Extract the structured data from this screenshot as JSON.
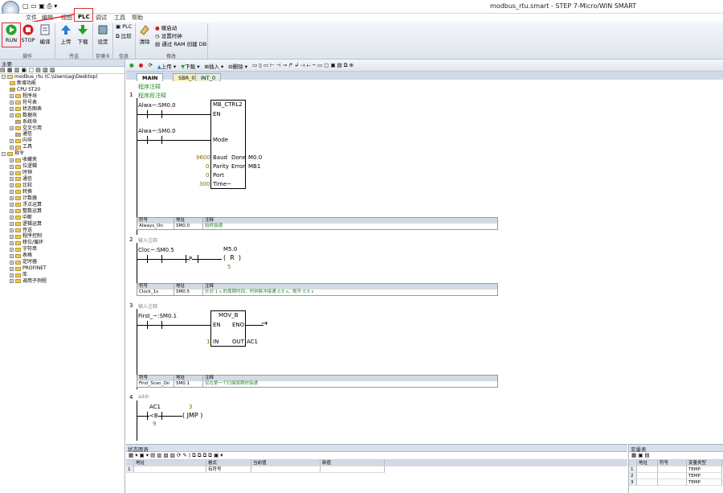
{
  "window": {
    "title": "modbus_rtu.smart - STEP 7-Micro/WIN SMART"
  },
  "menu": [
    "文件",
    "编辑",
    "视图",
    "PLC",
    "调试",
    "工具",
    "帮助"
  ],
  "ribbon": {
    "run": "RUN",
    "stop": "STOP",
    "compile": "编译",
    "upload": "上传",
    "download": "下载",
    "settings": "设定",
    "plc": "PLC",
    "compare": "比较",
    "clear": "清除",
    "power_on_reset": "暖启动",
    "set_clock": "设置时钟",
    "ram_to_db": "通过 RAM 创建 DB",
    "groups": [
      "操作",
      "传送",
      "存储卡",
      "信息",
      "修改"
    ]
  },
  "left_pane": {
    "header": "主要",
    "project": "modbus_rtu (C:\\Users\\ag\\Desktop)",
    "items": [
      "新增功能",
      "CPU ST20",
      "程序块",
      "符号表",
      "状态图表",
      "数据块",
      "系统块",
      "交叉引用",
      "通信",
      "向导",
      "工具"
    ],
    "instructions_header": "指令",
    "instructions": [
      "收藏夹",
      "位逻辑",
      "时钟",
      "通信",
      "比较",
      "转换",
      "计数器",
      "浮点运算",
      "整数运算",
      "中断",
      "逻辑运算",
      "传送",
      "程序控制",
      "移位/循环",
      "字符串",
      "表格",
      "定时器",
      "PROFINET",
      "库",
      "调用子例程"
    ]
  },
  "editor": {
    "toolbar": {
      "upload": "上传",
      "download": "下载",
      "insert": "插入",
      "delete": "删除"
    },
    "tabs": [
      "MAIN",
      "SBR_0",
      "INT_0"
    ],
    "program_comment": "程序注释",
    "networks": [
      {
        "num": "1",
        "comment": "程序段注释",
        "contacts": [
          "Alwa~:SM0.0",
          "Alwa~:SM0.0"
        ],
        "box": {
          "name": "MB_CTRL2",
          "en": "EN",
          "mode": "Mode",
          "baud": "Baud",
          "parity": "Parity",
          "port": "Port",
          "timeout": "Time~",
          "done": "Done",
          "error": "Error"
        },
        "inputs": {
          "baud": "9600",
          "parity": "0",
          "port": "0",
          "timeout": "300"
        },
        "outputs": {
          "done": "M0.0",
          "error": "MB1"
        },
        "symbols": {
          "headers": [
            "符号",
            "地址",
            "注释"
          ],
          "rows": [
            [
              "Always_On",
              "SM0.0",
              "始终接通"
            ]
          ]
        }
      },
      {
        "num": "2",
        "comment": "输入注释",
        "contact": "Cloc~:SM0.5",
        "edge": "P",
        "coil_addr": "M5.0",
        "coil": "R",
        "coil_n": "5",
        "symbols": {
          "headers": [
            "符号",
            "地址",
            "注释"
          ],
          "rows": [
            [
              "Clock_1s",
              "SM0.5",
              "针对 1 s 的周期时间，时钟脉冲接通 0.5 s，断开 0.5 s"
            ]
          ]
        }
      },
      {
        "num": "3",
        "comment": "输入注释",
        "contact": "First_~:SM0.1",
        "box": {
          "name": "MOV_B",
          "en": "EN",
          "eno": "ENO",
          "in": "IN",
          "out": "OUT"
        },
        "in_val": "1",
        "out_val": "AC1",
        "symbols": {
          "headers": [
            "符号",
            "地址",
            "注释"
          ],
          "rows": [
            [
              "First_Scan_On",
              "SM0.1",
              "仅在第一个扫描周期时接通"
            ]
          ]
        }
      },
      {
        "num": "4",
        "comment": "addr",
        "contact_top": "AC1",
        "cmp": "<B",
        "contact_bot": "9",
        "jmp_n": "3",
        "jmp": "JMP"
      }
    ]
  },
  "status_chart": {
    "title": "状态图表",
    "headers": [
      "地址",
      "格式",
      "当前值",
      "新值"
    ],
    "rows": [
      [
        "1",
        "",
        "有符号",
        "",
        ""
      ]
    ]
  },
  "var_table": {
    "title": "变量表",
    "headers": [
      "地址",
      "符号",
      "变量类型"
    ],
    "rows": [
      [
        "1",
        "",
        "TEMP"
      ],
      [
        "2",
        "",
        "TEMP"
      ],
      [
        "3",
        "",
        "TEMP"
      ]
    ]
  },
  "colors": {
    "accent": "#e03030",
    "ribbon": "#dfe5ee",
    "comment": "#2a8a2a"
  }
}
